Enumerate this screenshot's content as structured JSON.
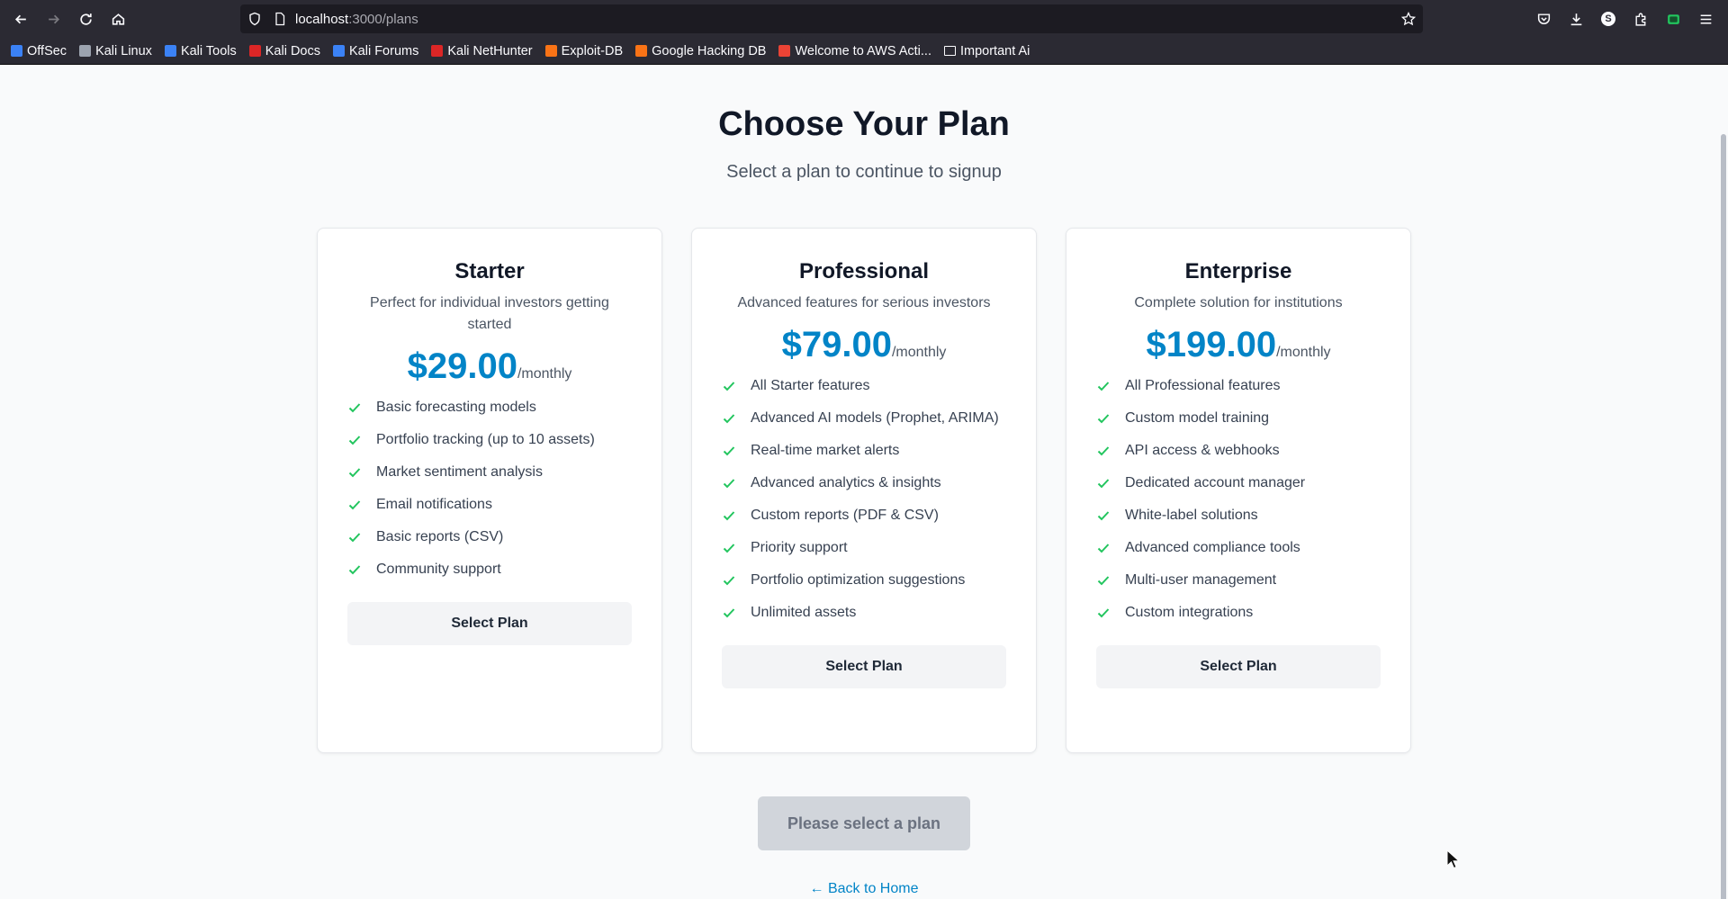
{
  "browser": {
    "url_host": "localhost",
    "url_path": ":3000/plans",
    "profile_initial": "S",
    "bookmarks": [
      {
        "label": "OffSec",
        "color": "#3b82f6"
      },
      {
        "label": "Kali Linux",
        "color": "#9ca3af"
      },
      {
        "label": "Kali Tools",
        "color": "#3b82f6"
      },
      {
        "label": "Kali Docs",
        "color": "#dc2626"
      },
      {
        "label": "Kali Forums",
        "color": "#3b82f6"
      },
      {
        "label": "Kali NetHunter",
        "color": "#dc2626"
      },
      {
        "label": "Exploit-DB",
        "color": "#f97316"
      },
      {
        "label": "Google Hacking DB",
        "color": "#f97316"
      },
      {
        "label": "Welcome to AWS Acti...",
        "color": "#ea4335"
      },
      {
        "label": "Important Ai",
        "color": "folder"
      }
    ]
  },
  "header": {
    "title": "Choose Your Plan",
    "subtitle": "Select a plan to continue to signup"
  },
  "plans": [
    {
      "name": "Starter",
      "description": "Perfect for individual investors getting started",
      "price": "$29.00",
      "period": "/monthly",
      "features": [
        "Basic forecasting models",
        "Portfolio tracking (up to 10 assets)",
        "Market sentiment analysis",
        "Email notifications",
        "Basic reports (CSV)",
        "Community support"
      ],
      "button": "Select Plan"
    },
    {
      "name": "Professional",
      "description": "Advanced features for serious investors",
      "price": "$79.00",
      "period": "/monthly",
      "features": [
        "All Starter features",
        "Advanced AI models (Prophet, ARIMA)",
        "Real-time market alerts",
        "Advanced analytics & insights",
        "Custom reports (PDF & CSV)",
        "Priority support",
        "Portfolio optimization suggestions",
        "Unlimited assets"
      ],
      "button": "Select Plan"
    },
    {
      "name": "Enterprise",
      "description": "Complete solution for institutions",
      "price": "$199.00",
      "period": "/monthly",
      "features": [
        "All Professional features",
        "Custom model training",
        "API access & webhooks",
        "Dedicated account manager",
        "White-label solutions",
        "Advanced compliance tools",
        "Multi-user management",
        "Custom integrations"
      ],
      "button": "Select Plan"
    }
  ],
  "footer": {
    "continue_label": "Please select a plan",
    "back_label": "← Back to Home"
  },
  "colors": {
    "accent": "#0284c7",
    "check": "#22c55e"
  }
}
